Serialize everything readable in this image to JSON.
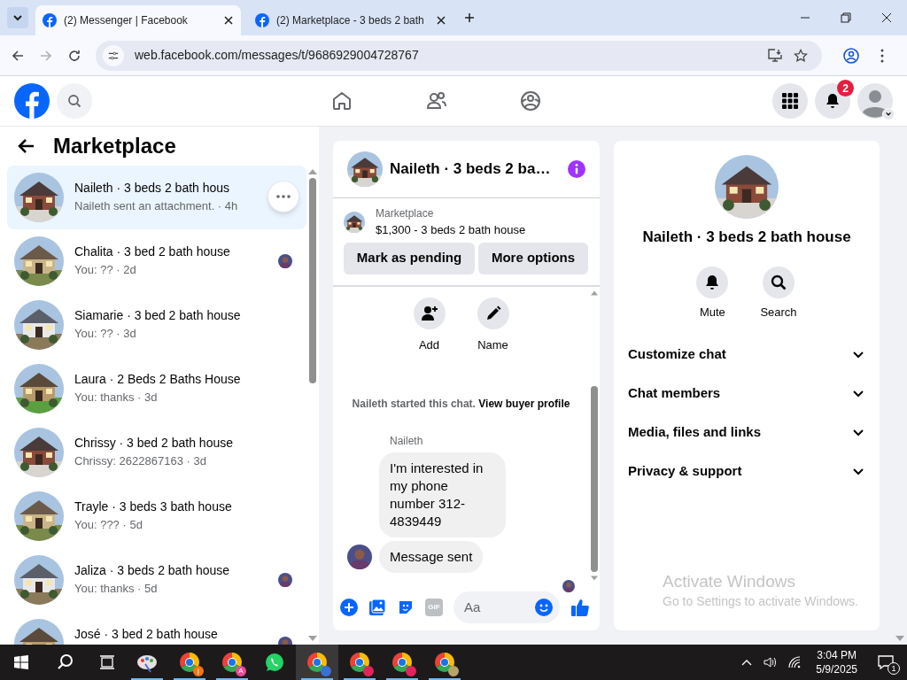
{
  "browser": {
    "tabs": [
      {
        "title": "(2) Messenger | Facebook",
        "selected": true
      },
      {
        "title": "(2) Marketplace - 3 beds 2 bath",
        "selected": false
      }
    ],
    "url": "web.facebook.com/messages/t/9686929004728767"
  },
  "header": {
    "notification_count": "2"
  },
  "sidebar": {
    "title": "Marketplace",
    "conversations": [
      {
        "title": "Naileth · 3 beds 2 bath hous",
        "preview": "Naileth sent an attachment. · 4h",
        "selected": true,
        "seen": false
      },
      {
        "title": "Chalita · 3 bed 2 bath house",
        "preview": "You: ?? · 2d",
        "selected": false,
        "seen": true
      },
      {
        "title": "Siamarie · 3 bed 2 bath house",
        "preview": "You: ?? · 3d",
        "selected": false,
        "seen": false
      },
      {
        "title": "Laura · 2 Beds 2 Baths House",
        "preview": "You: thanks · 3d",
        "selected": false,
        "seen": false
      },
      {
        "title": "Chrissy · 3 bed 2 bath house",
        "preview": "Chrissy: 2622867163 · 3d",
        "selected": false,
        "seen": false
      },
      {
        "title": "Trayle · 3 beds 3 bath house",
        "preview": "You: ??? · 5d",
        "selected": false,
        "seen": false
      },
      {
        "title": "Jaliza · 3 beds 2 bath house",
        "preview": "You: thanks · 5d",
        "selected": false,
        "seen": true
      },
      {
        "title": "José · 3 bed 2 bath house",
        "selected": false,
        "seen": true
      }
    ]
  },
  "chat": {
    "title": "Naileth · 3 beds 2 ba…",
    "listing": {
      "label": "Marketplace",
      "price": "$1,300 - 3 beds 2 bath house"
    },
    "actions": [
      "Mark as pending",
      "More options"
    ],
    "quick_actions": [
      {
        "label": "Add",
        "kind": "add-person"
      },
      {
        "label": "Name",
        "kind": "rename"
      }
    ],
    "notice_text": "Naileth started this chat.",
    "notice_link": "View buyer profile",
    "messages": {
      "sender": "Naileth",
      "bubbles": [
        "I'm interested in my phone number 312-4839449",
        "Message sent"
      ]
    },
    "composer": {
      "gif_label": "GIF",
      "placeholder": "Aa"
    }
  },
  "details": {
    "title": "Naileth · 3 beds 2 bath house",
    "actions": [
      {
        "label": "Mute",
        "kind": "mute"
      },
      {
        "label": "Search",
        "kind": "search"
      }
    ],
    "sections": [
      {
        "label": "Customize chat",
        "expanded": false
      },
      {
        "label": "Chat members",
        "expanded": false
      },
      {
        "label": "Media, files and links",
        "expanded": false
      },
      {
        "label": "Privacy & support",
        "expanded": false
      }
    ]
  },
  "activation_notice": {
    "title": "Activate Windows",
    "text": "Go to Settings to activate Windows."
  },
  "taskbar": {
    "apps": [
      {
        "kind": "paint",
        "running": true,
        "selected": false
      },
      {
        "kind": "browser",
        "badge": "j",
        "color": "#f97316",
        "running": true,
        "selected": false
      },
      {
        "kind": "browser",
        "badge": "A",
        "color": "#ec4899",
        "running": true,
        "selected": false
      },
      {
        "kind": "whatsapp",
        "running": false,
        "selected": false
      },
      {
        "kind": "browser",
        "color": "#3b6fd8",
        "running": true,
        "selected": true
      },
      {
        "kind": "browser",
        "color": "#e0245e",
        "running": true,
        "selected": false
      },
      {
        "kind": "browser",
        "color": "#e0245e",
        "running": true,
        "selected": false
      },
      {
        "kind": "browser",
        "color": "#b8a46a",
        "running": true,
        "selected": false
      }
    ],
    "time": "3:04 PM",
    "date": "5/9/2025",
    "notifications": "1"
  }
}
